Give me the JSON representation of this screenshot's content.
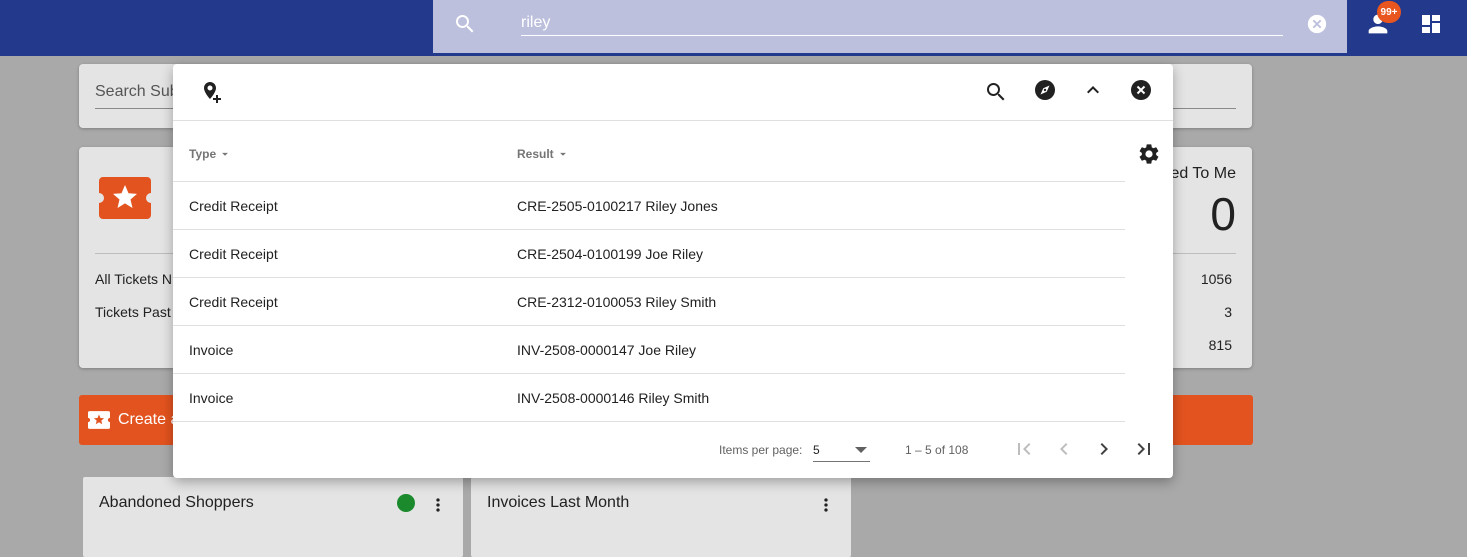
{
  "search": {
    "query": "riley"
  },
  "header": {
    "notification_badge": "99+"
  },
  "background": {
    "search_placeholder": "Search Sub",
    "tickets": {
      "rows": [
        {
          "label": "All Tickets N",
          "value": "1056"
        },
        {
          "label": "Tickets Past",
          "value": "3"
        },
        {
          "label": "",
          "value": "815"
        }
      ],
      "assigned_label": "ed To Me",
      "assigned_count": "0"
    },
    "create_label": "Create a",
    "widgets": [
      {
        "title": "Abandoned Shoppers",
        "status_color": "#1b8a2d"
      },
      {
        "title": "Invoices Last Month"
      }
    ]
  },
  "results_panel": {
    "columns": {
      "type": "Type",
      "result": "Result"
    },
    "rows": [
      {
        "type": "Credit Receipt",
        "result": "CRE-2505-0100217 Riley Jones"
      },
      {
        "type": "Credit Receipt",
        "result": "CRE-2504-0100199 Joe Riley"
      },
      {
        "type": "Credit Receipt",
        "result": "CRE-2312-0100053 Riley Smith"
      },
      {
        "type": "Invoice",
        "result": "INV-2508-0000147 Joe Riley"
      },
      {
        "type": "Invoice",
        "result": "INV-2508-0000146 Riley Smith"
      }
    ],
    "paginator": {
      "items_per_page_label": "Items per page:",
      "items_per_page": "5",
      "range": "1 – 5 of 108"
    }
  },
  "colors": {
    "app_bar": "#233a8c",
    "search_bar": "#bcc0dd",
    "accent_orange": "#e3531f",
    "status_green": "#1b8a2d"
  },
  "icons": {
    "search": "search-icon",
    "clear": "clear-icon",
    "user": "person-icon",
    "dashboard": "dashboard-icon",
    "add_location": "add-location-icon",
    "explore": "compass-icon",
    "collapse": "chevron-up-icon",
    "close": "close-circle-icon",
    "settings": "gear-icon"
  }
}
